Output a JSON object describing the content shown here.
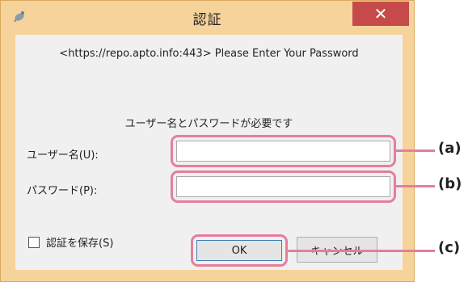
{
  "window": {
    "title": "認証",
    "close_icon": "close-icon",
    "app_icon": "satellite-icon"
  },
  "content": {
    "banner": "<https://repo.apto.info:443> Please Enter Your Password",
    "prompt": "ユーザー名とパスワードが必要です",
    "username_label": "ユーザー名(U):",
    "username_value": "",
    "password_label": "パスワード(P):",
    "password_value": "",
    "save_checkbox_label": "認証を保存(S)",
    "save_checked": false,
    "ok_label": "OK",
    "cancel_label": "キャンセル"
  },
  "callouts": {
    "a": "(a)",
    "b": "(b)",
    "c": "(c)"
  },
  "colors": {
    "window_frame": "#f6d39a",
    "highlight": "#e47f9a",
    "close_button": "#c74a4a"
  }
}
